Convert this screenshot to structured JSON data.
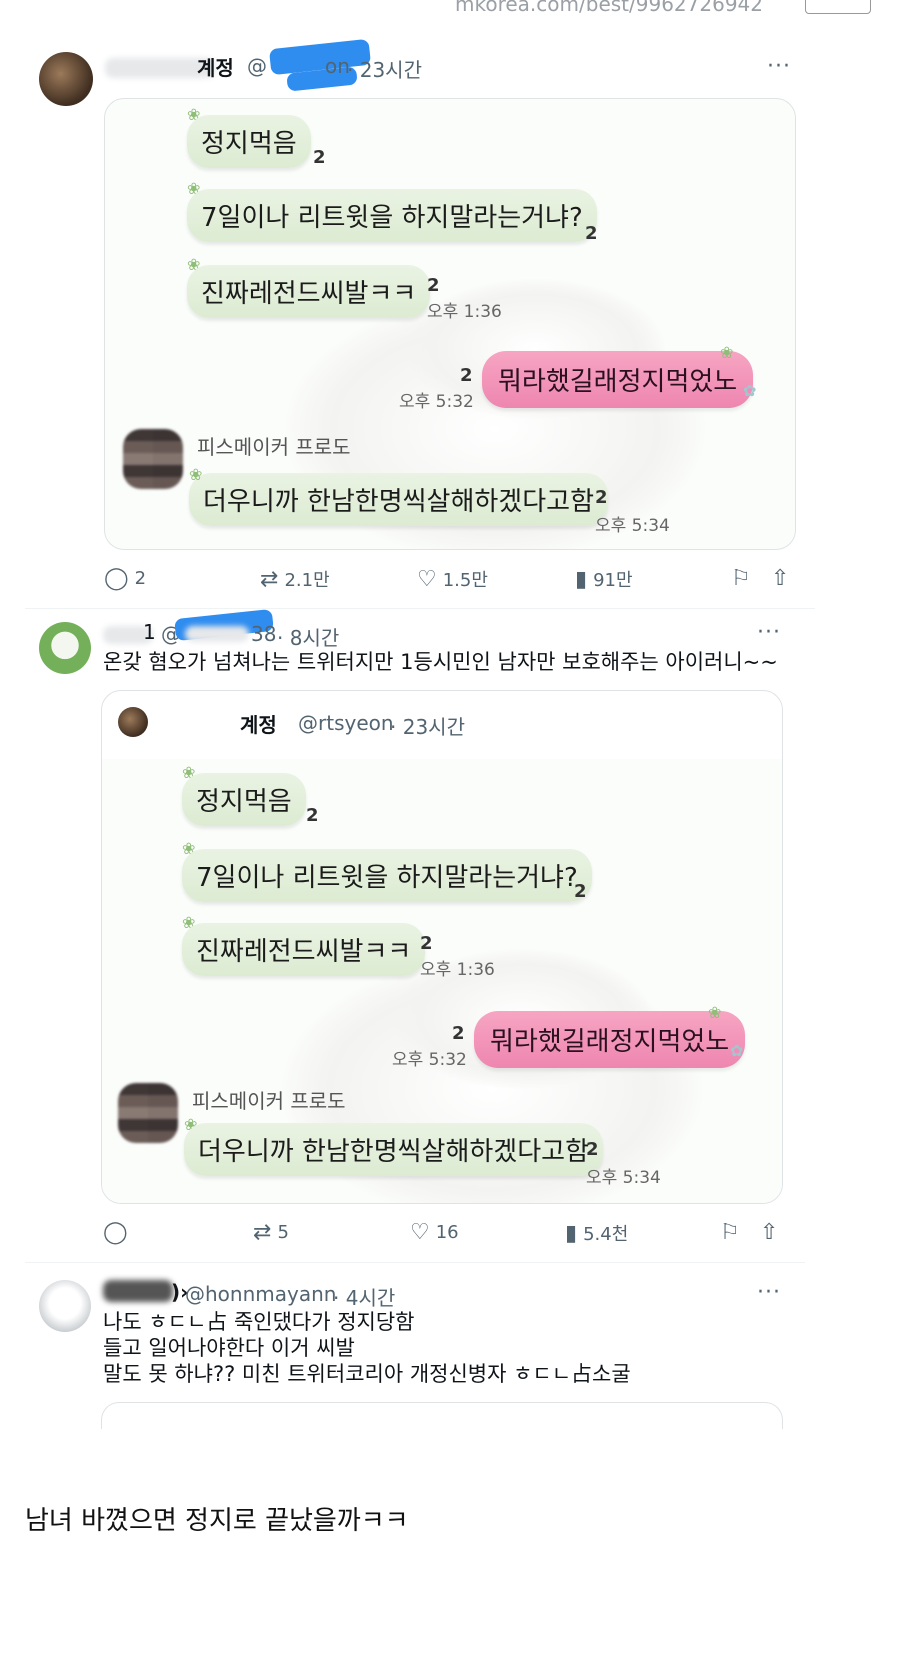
{
  "page": {
    "top_url": "mkorea.com/best/9962726942",
    "caption": "남녀 바꼈으면 정지로 끝났을까ㅋㅋ"
  },
  "tweet1": {
    "username": "계정",
    "handle_start": "@",
    "handle_end": "on",
    "time": "· 23시간",
    "more": "···",
    "chat": {
      "msg1": "정지먹음",
      "msg1_count": "2",
      "msg2": "7일이나 리트윗을 하지말라는거냐?",
      "msg2_count": "2",
      "msg3": "진짜레전드씨발ㅋㅋ",
      "msg3_count": "2",
      "msg3_time": "오후 1:36",
      "msg4": "뭐라했길래정지먹었노",
      "msg4_count": "2",
      "msg4_time": "오후 5:32",
      "sender": "피스메이커 프로도",
      "msg5": "더우니까 한남한명씩살해하겠다고함",
      "msg5_count": "2",
      "msg5_time": "오후 5:34"
    },
    "actions": {
      "replies": "2",
      "retweets": "2.1만",
      "likes": "1.5만",
      "views": "91만"
    }
  },
  "tweet2": {
    "username": "1",
    "handle_start": "@",
    "handle_end": "38",
    "time": "· 8시간",
    "more": "···",
    "text": "온갖 혐오가 넘쳐나는 트위터지만 1등시민인 남자만 보호해주는 아이러니~~",
    "quote": {
      "username": "계정",
      "handle": "@rtsyeon",
      "time": "· 23시간",
      "chat": {
        "msg1": "정지먹음",
        "msg1_count": "2",
        "msg2": "7일이나 리트윗을 하지말라는거냐?",
        "msg2_count": "2",
        "msg3": "진짜레전드씨발ㅋㅋ",
        "msg3_count": "2",
        "msg3_time": "오후 1:36",
        "msg4": "뭐라했길래정지먹었노",
        "msg4_count": "2",
        "msg4_time": "오후 5:32",
        "sender": "피스메이커 프로도",
        "msg5": "더우니까 한남한명씩살해하겠다고함",
        "msg5_count": "2",
        "msg5_time": "오후 5:34"
      }
    },
    "actions": {
      "replies": "",
      "retweets": "5",
      "likes": "16",
      "views": "5.4천"
    }
  },
  "tweet3": {
    "username": ")›",
    "handle": "@honnmayann",
    "time": "· 4시간",
    "more": "···",
    "line1": "나도 ㅎㄷㄴ占 죽인댔다가 정지당함",
    "line2": "들고 일어나야한다 이거 씨발",
    "line3": "말도 못 하냐?? 미친 트위터코리아 개정신병자 ㅎㄷㄴ占소굴"
  },
  "icons": {
    "reply": "reply-icon",
    "retweet": "retweet-icon",
    "like": "heart-icon",
    "views": "views-icon",
    "bookmark": "bookmark-icon",
    "share": "share-icon",
    "more": "more-icon"
  },
  "colors": {
    "pink_bubble": "#ee86b0",
    "green_bubble": "#dcebd2",
    "redaction": "#2f8df0"
  }
}
